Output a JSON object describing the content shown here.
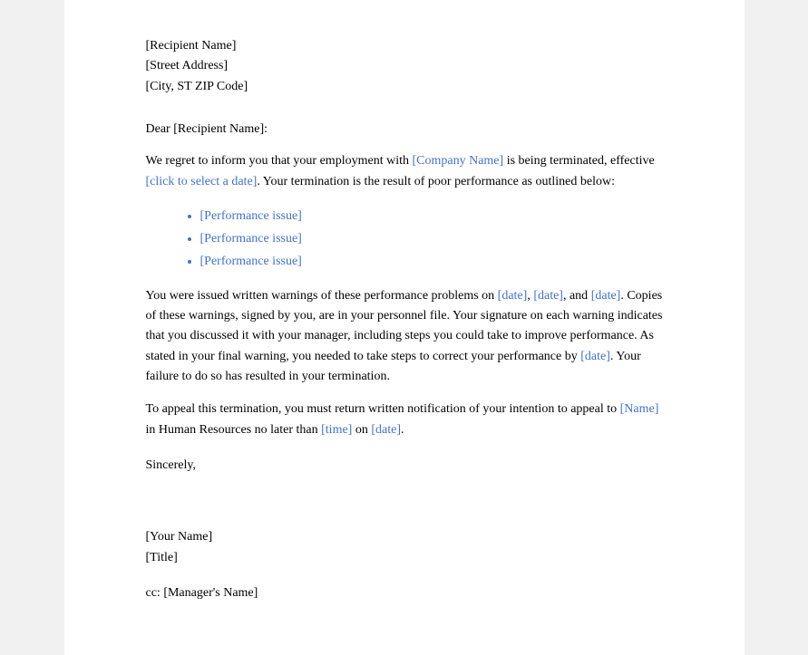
{
  "address": {
    "recipient_name": "[Recipient Name]",
    "street": "[Street Address]",
    "city": "[City, ST ZIP Code]"
  },
  "salutation": "Dear [Recipient Name]:",
  "paragraph1_pre": "We regret to inform you that your employment with ",
  "paragraph1_company": "[Company Name]",
  "paragraph1_mid": " is being terminated, effective ",
  "paragraph1_date_link": "[click to select a date]",
  "paragraph1_post": ". Your termination is the result of poor performance as outlined below:",
  "bullets": [
    "[Performance issue]",
    "[Performance issue]",
    "[Performance issue]"
  ],
  "paragraph2_pre": "You were issued written warnings of these performance problems on ",
  "paragraph2_date1": "[date]",
  "paragraph2_sep1": ", ",
  "paragraph2_date2": "[date]",
  "paragraph2_sep2": ", and ",
  "paragraph2_date3": "[date]",
  "paragraph2_post1": ". Copies of these warnings, signed by you, are in your personnel file. Your signature on each warning indicates  that you discussed it with your manager, including  steps you could take to improve performance. As stated in your final warning, you needed to take steps to correct your performance by ",
  "paragraph2_date4": "[date]",
  "paragraph2_post2": ". Your failure to do so has resulted in your termination.",
  "paragraph3_pre": "To appeal this termination, you must return written notification of your intention to appeal to ",
  "paragraph3_name": "[Name]",
  "paragraph3_mid": " in Human Resources no later than ",
  "paragraph3_time": "[time]",
  "paragraph3_sep": " on ",
  "paragraph3_date": "[date]",
  "paragraph3_post": ".",
  "sincerely": "Sincerely,",
  "signature": {
    "name": "[Your Name]",
    "title": "[Title]"
  },
  "cc": "cc: [Manager's Name]"
}
